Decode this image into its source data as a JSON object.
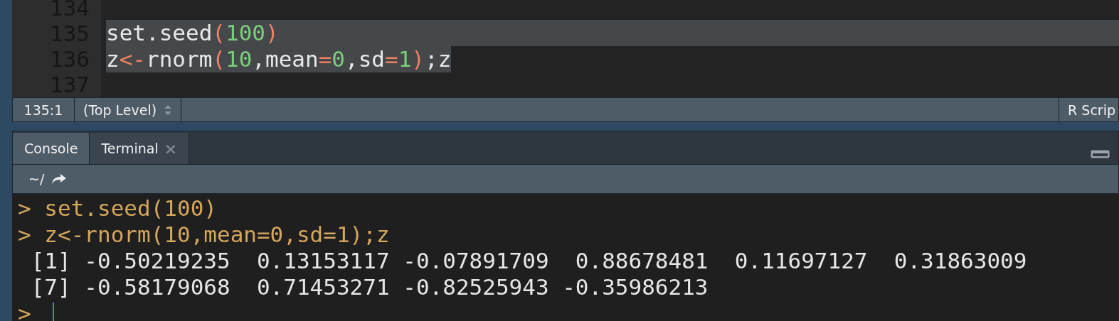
{
  "editor": {
    "lines": [
      {
        "number": "134"
      },
      {
        "number": "135",
        "selected": true,
        "tokens": [
          {
            "kind": "plain",
            "text": "set.seed"
          },
          {
            "kind": "paren",
            "text": "("
          },
          {
            "kind": "number",
            "text": "100"
          },
          {
            "kind": "paren",
            "text": ")"
          }
        ]
      },
      {
        "number": "136",
        "selected": true,
        "tokens": [
          {
            "kind": "plain",
            "text": "z"
          },
          {
            "kind": "operator",
            "text": "<-"
          },
          {
            "kind": "plain",
            "text": "rnorm"
          },
          {
            "kind": "paren",
            "text": "("
          },
          {
            "kind": "number",
            "text": "10"
          },
          {
            "kind": "plain",
            "text": ",mean"
          },
          {
            "kind": "operator",
            "text": "="
          },
          {
            "kind": "number",
            "text": "0"
          },
          {
            "kind": "plain",
            "text": ",sd"
          },
          {
            "kind": "operator",
            "text": "="
          },
          {
            "kind": "number",
            "text": "1"
          },
          {
            "kind": "paren",
            "text": ")"
          },
          {
            "kind": "plain",
            "text": ";z"
          }
        ]
      },
      {
        "number": "137"
      }
    ]
  },
  "status_bar": {
    "position": "135:1",
    "scope": "(Top Level)",
    "file_type": "R Scrip"
  },
  "tabs": [
    {
      "label": "Console",
      "selected": true,
      "closable": false
    },
    {
      "label": "Terminal",
      "selected": false,
      "closable": true,
      "close": "×"
    }
  ],
  "toolbar": {
    "path": "~/"
  },
  "console": {
    "lines": [
      {
        "kind": "input",
        "prompt": ">",
        "text": "set.seed(100)"
      },
      {
        "kind": "input",
        "prompt": ">",
        "text": "z<-rnorm(10,mean=0,sd=1);z"
      },
      {
        "kind": "output",
        "text": " [1] -0.50219235  0.13153117 -0.07891709  0.88678481  0.11697127  0.31863009"
      },
      {
        "kind": "output",
        "text": " [7] -0.58179068  0.71453271 -0.82525943 -0.35986213"
      },
      {
        "kind": "prompt",
        "prompt": ">"
      }
    ]
  }
}
